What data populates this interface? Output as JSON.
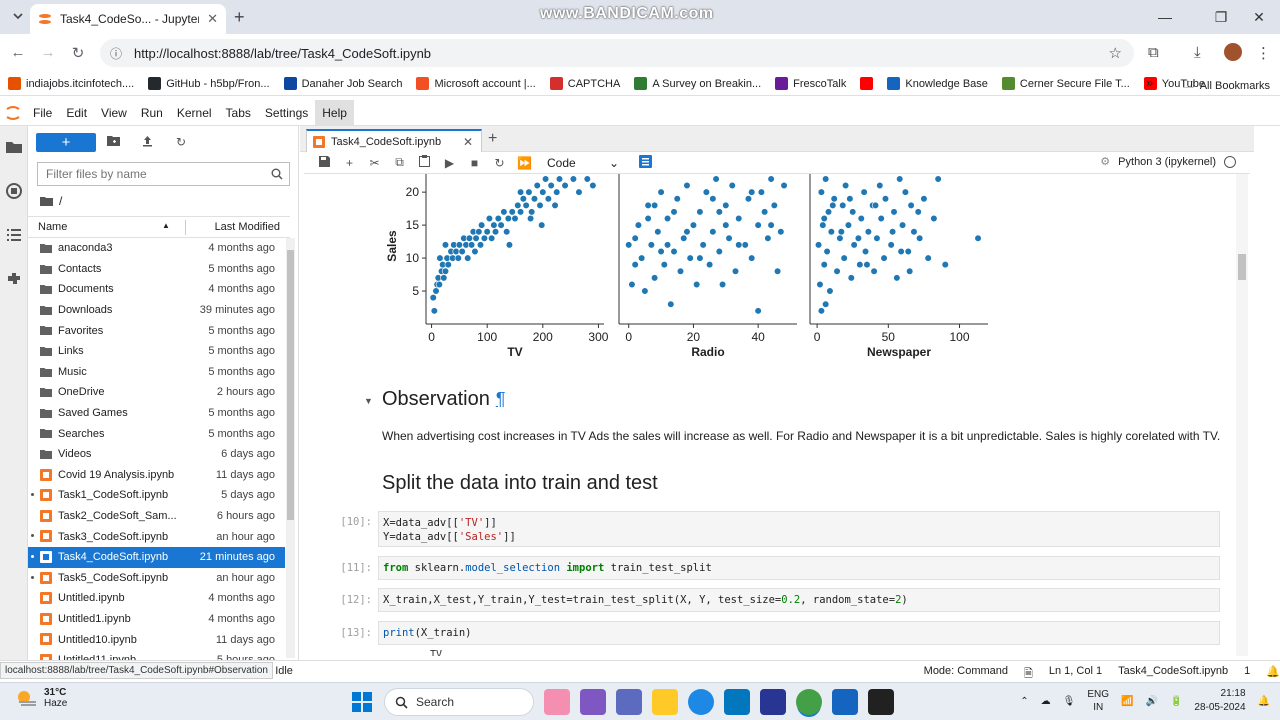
{
  "browser": {
    "tab_title": "Task4_CodeSo... - JupyterLab",
    "watermark": "www.BANDICAM.com",
    "url": "http://localhost:8888/lab/tree/Task4_CodeSoft.ipynb",
    "bookmarks": [
      {
        "label": "indiajobs.itcinfotech....",
        "color": "#e65100"
      },
      {
        "label": "GitHub - h5bp/Fron...",
        "color": "#24292e"
      },
      {
        "label": "Danaher Job Search",
        "color": "#0d47a1"
      },
      {
        "label": "Microsoft account |...",
        "color": "#f25022"
      },
      {
        "label": "CAPTCHA",
        "color": "#d32f2f"
      },
      {
        "label": "A Survey on Breakin...",
        "color": "#2e7d32"
      },
      {
        "label": "FrescoTalk",
        "color": "#6a1b9a"
      },
      {
        "label": "",
        "color": "#ff0000"
      },
      {
        "label": "Knowledge Base",
        "color": "#1565c0"
      },
      {
        "label": "Cerner Secure File T...",
        "color": "#558b2f"
      },
      {
        "label": "YouTube",
        "color": "#ff0000"
      }
    ],
    "more_bookmarks": "»",
    "all_bookmarks": "All Bookmarks"
  },
  "menu": [
    "File",
    "Edit",
    "View",
    "Run",
    "Kernel",
    "Tabs",
    "Settings",
    "Help"
  ],
  "filebrowser": {
    "new_label": "+",
    "filter_placeholder": "Filter files by name",
    "breadcrumb": "/",
    "col_name": "Name",
    "col_modified": "Last Modified",
    "files": [
      {
        "name": "anaconda3",
        "mod": "4 months ago",
        "type": "folder",
        "running": false
      },
      {
        "name": "Contacts",
        "mod": "5 months ago",
        "type": "folder",
        "running": false
      },
      {
        "name": "Documents",
        "mod": "4 months ago",
        "type": "folder",
        "running": false
      },
      {
        "name": "Downloads",
        "mod": "39 minutes ago",
        "type": "folder",
        "running": false
      },
      {
        "name": "Favorites",
        "mod": "5 months ago",
        "type": "folder",
        "running": false
      },
      {
        "name": "Links",
        "mod": "5 months ago",
        "type": "folder",
        "running": false
      },
      {
        "name": "Music",
        "mod": "5 months ago",
        "type": "folder",
        "running": false
      },
      {
        "name": "OneDrive",
        "mod": "2 hours ago",
        "type": "folder",
        "running": false
      },
      {
        "name": "Saved Games",
        "mod": "5 months ago",
        "type": "folder",
        "running": false
      },
      {
        "name": "Searches",
        "mod": "5 months ago",
        "type": "folder",
        "running": false
      },
      {
        "name": "Videos",
        "mod": "6 days ago",
        "type": "folder",
        "running": false
      },
      {
        "name": "Covid 19 Analysis.ipynb",
        "mod": "11 days ago",
        "type": "notebook",
        "running": false
      },
      {
        "name": "Task1_CodeSoft.ipynb",
        "mod": "5 days ago",
        "type": "notebook",
        "running": true
      },
      {
        "name": "Task2_CodeSoft_Sam...",
        "mod": "6 hours ago",
        "type": "notebook",
        "running": false
      },
      {
        "name": "Task3_CodeSoft.ipynb",
        "mod": "an hour ago",
        "type": "notebook",
        "running": true
      },
      {
        "name": "Task4_CodeSoft.ipynb",
        "mod": "21 minutes ago",
        "type": "notebook",
        "running": true,
        "selected": true
      },
      {
        "name": "Task5_CodeSoft.ipynb",
        "mod": "an hour ago",
        "type": "notebook",
        "running": true
      },
      {
        "name": "Untitled.ipynb",
        "mod": "4 months ago",
        "type": "notebook",
        "running": false
      },
      {
        "name": "Untitled1.ipynb",
        "mod": "4 months ago",
        "type": "notebook",
        "running": false
      },
      {
        "name": "Untitled10.ipynb",
        "mod": "11 days ago",
        "type": "notebook",
        "running": false
      },
      {
        "name": "Untitled11.ipynb",
        "mod": "5 hours ago",
        "type": "notebook",
        "running": false
      }
    ]
  },
  "notebook": {
    "tab_title": "Task4_CodeSoft.ipynb",
    "cell_type": "Code",
    "kernel": "Python 3 (ipykernel)",
    "observation_heading": "Observation",
    "pilcrow": "¶",
    "observation_text": "When advertising cost increases in TV Ads the sales will increase as well. For Radio and Newspaper it is a bit unpredictable. Sales is highly corelated with TV.",
    "split_heading": "Split the data into train and test",
    "cells": [
      {
        "prompt": "[10]:",
        "lines": [
          "X=data_adv[['TV']]",
          "Y=data_adv[['Sales']]"
        ]
      },
      {
        "prompt": "[11]:",
        "lines": [
          "from sklearn.model_selection import train_test_split"
        ]
      },
      {
        "prompt": "[12]:",
        "lines": [
          "X_train,X_test,Y_train,Y_test=train_test_split(X, Y, test_size=0.2, random_state=2)"
        ]
      },
      {
        "prompt": "[13]:",
        "lines": [
          "print(X_train)"
        ]
      }
    ],
    "output_fragment": "TV"
  },
  "chart_data": {
    "type": "scatter",
    "ylabel": "Sales",
    "ylim": [
      0,
      27
    ],
    "yticks": [
      5,
      10,
      15,
      20,
      25
    ],
    "point_color": "#1f77b4",
    "panels": [
      {
        "xlabel": "TV",
        "xlim": [
          -10,
          310
        ],
        "xticks": [
          0,
          100,
          200,
          300
        ],
        "points": [
          [
            5,
            2
          ],
          [
            8,
            5
          ],
          [
            10,
            6
          ],
          [
            12,
            7
          ],
          [
            14,
            6
          ],
          [
            18,
            8
          ],
          [
            20,
            9
          ],
          [
            22,
            7
          ],
          [
            25,
            8
          ],
          [
            28,
            10
          ],
          [
            30,
            9
          ],
          [
            35,
            11
          ],
          [
            38,
            10
          ],
          [
            40,
            12
          ],
          [
            44,
            11
          ],
          [
            48,
            10
          ],
          [
            50,
            12
          ],
          [
            55,
            11
          ],
          [
            58,
            13
          ],
          [
            62,
            12
          ],
          [
            65,
            10
          ],
          [
            68,
            13
          ],
          [
            72,
            12
          ],
          [
            75,
            14
          ],
          [
            78,
            11
          ],
          [
            80,
            13
          ],
          [
            85,
            14
          ],
          [
            88,
            12
          ],
          [
            90,
            15
          ],
          [
            95,
            13
          ],
          [
            100,
            14
          ],
          [
            104,
            16
          ],
          [
            108,
            13
          ],
          [
            112,
            15
          ],
          [
            115,
            14
          ],
          [
            120,
            16
          ],
          [
            125,
            15
          ],
          [
            130,
            17
          ],
          [
            135,
            14
          ],
          [
            138,
            16
          ],
          [
            140,
            12
          ],
          [
            145,
            17
          ],
          [
            150,
            16
          ],
          [
            155,
            18
          ],
          [
            160,
            17
          ],
          [
            165,
            19
          ],
          [
            170,
            18
          ],
          [
            175,
            20
          ],
          [
            180,
            17
          ],
          [
            185,
            19
          ],
          [
            190,
            21
          ],
          [
            195,
            18
          ],
          [
            200,
            20
          ],
          [
            205,
            22
          ],
          [
            210,
            19
          ],
          [
            215,
            21
          ],
          [
            220,
            23
          ],
          [
            225,
            20
          ],
          [
            230,
            22
          ],
          [
            235,
            24
          ],
          [
            240,
            21
          ],
          [
            245,
            23
          ],
          [
            250,
            25
          ],
          [
            255,
            22
          ],
          [
            260,
            24
          ],
          [
            265,
            20
          ],
          [
            270,
            23
          ],
          [
            275,
            25
          ],
          [
            280,
            22
          ],
          [
            285,
            24
          ],
          [
            290,
            21
          ],
          [
            295,
            23
          ],
          [
            198,
            15
          ],
          [
            178,
            16
          ],
          [
            160,
            20
          ],
          [
            222,
            18
          ],
          [
            240,
            25
          ],
          [
            265,
            26
          ],
          [
            285,
            26
          ],
          [
            15,
            10
          ],
          [
            3,
            4
          ],
          [
            25,
            12
          ]
        ]
      },
      {
        "xlabel": "Radio",
        "xlim": [
          -3,
          52
        ],
        "xticks": [
          0,
          20,
          40
        ],
        "points": [
          [
            0,
            12
          ],
          [
            1,
            6
          ],
          [
            2,
            9
          ],
          [
            3,
            15
          ],
          [
            4,
            10
          ],
          [
            5,
            5
          ],
          [
            6,
            18
          ],
          [
            7,
            12
          ],
          [
            8,
            7
          ],
          [
            9,
            14
          ],
          [
            10,
            20
          ],
          [
            11,
            9
          ],
          [
            12,
            16
          ],
          [
            13,
            3
          ],
          [
            14,
            11
          ],
          [
            15,
            19
          ],
          [
            16,
            8
          ],
          [
            17,
            13
          ],
          [
            18,
            21
          ],
          [
            19,
            10
          ],
          [
            20,
            15
          ],
          [
            21,
            6
          ],
          [
            22,
            17
          ],
          [
            23,
            12
          ],
          [
            24,
            20
          ],
          [
            25,
            9
          ],
          [
            26,
            14
          ],
          [
            27,
            22
          ],
          [
            28,
            11
          ],
          [
            29,
            6
          ],
          [
            30,
            18
          ],
          [
            31,
            13
          ],
          [
            32,
            21
          ],
          [
            33,
            8
          ],
          [
            34,
            16
          ],
          [
            35,
            23
          ],
          [
            36,
            12
          ],
          [
            37,
            19
          ],
          [
            38,
            10
          ],
          [
            39,
            24
          ],
          [
            40,
            15
          ],
          [
            41,
            20
          ],
          [
            42,
            26
          ],
          [
            43,
            13
          ],
          [
            44,
            22
          ],
          [
            45,
            18
          ],
          [
            46,
            25
          ],
          [
            47,
            14
          ],
          [
            48,
            21
          ],
          [
            49,
            24
          ],
          [
            2,
            13
          ],
          [
            6,
            16
          ],
          [
            10,
            11
          ],
          [
            14,
            17
          ],
          [
            18,
            14
          ],
          [
            22,
            10
          ],
          [
            26,
            19
          ],
          [
            30,
            15
          ],
          [
            34,
            12
          ],
          [
            38,
            20
          ],
          [
            42,
            17
          ],
          [
            46,
            8
          ],
          [
            40,
            2
          ],
          [
            12,
            12
          ],
          [
            8,
            18
          ],
          [
            28,
            17
          ],
          [
            36,
            25
          ],
          [
            44,
            15
          ]
        ]
      },
      {
        "xlabel": "Newspaper",
        "xlim": [
          -5,
          120
        ],
        "xticks": [
          0,
          50,
          100
        ],
        "points": [
          [
            1,
            12
          ],
          [
            2,
            6
          ],
          [
            3,
            20
          ],
          [
            4,
            15
          ],
          [
            5,
            9
          ],
          [
            6,
            22
          ],
          [
            7,
            11
          ],
          [
            8,
            17
          ],
          [
            9,
            5
          ],
          [
            10,
            14
          ],
          [
            12,
            19
          ],
          [
            14,
            8
          ],
          [
            15,
            24
          ],
          [
            16,
            13
          ],
          [
            18,
            18
          ],
          [
            19,
            10
          ],
          [
            20,
            21
          ],
          [
            22,
            15
          ],
          [
            24,
            7
          ],
          [
            25,
            17
          ],
          [
            26,
            12
          ],
          [
            28,
            23
          ],
          [
            30,
            9
          ],
          [
            31,
            16
          ],
          [
            33,
            20
          ],
          [
            34,
            11
          ],
          [
            36,
            14
          ],
          [
            38,
            25
          ],
          [
            39,
            18
          ],
          [
            40,
            8
          ],
          [
            42,
            13
          ],
          [
            44,
            21
          ],
          [
            45,
            16
          ],
          [
            47,
            10
          ],
          [
            48,
            19
          ],
          [
            50,
            24
          ],
          [
            52,
            12
          ],
          [
            54,
            17
          ],
          [
            56,
            7
          ],
          [
            58,
            22
          ],
          [
            60,
            15
          ],
          [
            62,
            20
          ],
          [
            64,
            11
          ],
          [
            66,
            18
          ],
          [
            68,
            14
          ],
          [
            70,
            23
          ],
          [
            72,
            13
          ],
          [
            75,
            19
          ],
          [
            78,
            10
          ],
          [
            82,
            16
          ],
          [
            85,
            22
          ],
          [
            90,
            9
          ],
          [
            100,
            24
          ],
          [
            113,
            13
          ],
          [
            3,
            2
          ],
          [
            6,
            3
          ],
          [
            5,
            16
          ],
          [
            11,
            18
          ],
          [
            17,
            14
          ],
          [
            23,
            19
          ],
          [
            29,
            13
          ],
          [
            35,
            9
          ],
          [
            41,
            18
          ],
          [
            53,
            14
          ],
          [
            59,
            11
          ],
          [
            65,
            8
          ],
          [
            71,
            17
          ]
        ]
      }
    ]
  },
  "statusbar": {
    "link_tip": "localhost:8888/lab/tree/Task4_CodeSoft.ipynb#Observation",
    "left_fragment": "el) | Idle",
    "mode": "Mode: Command",
    "position": "Ln 1, Col 1",
    "file": "Task4_CodeSoft.ipynb",
    "count": "1"
  },
  "taskbar": {
    "temp": "31°C",
    "weather": "Haze",
    "search": "Search",
    "lang1": "ENG",
    "lang2": "IN",
    "time": "21:18",
    "date": "28-05-2024"
  }
}
